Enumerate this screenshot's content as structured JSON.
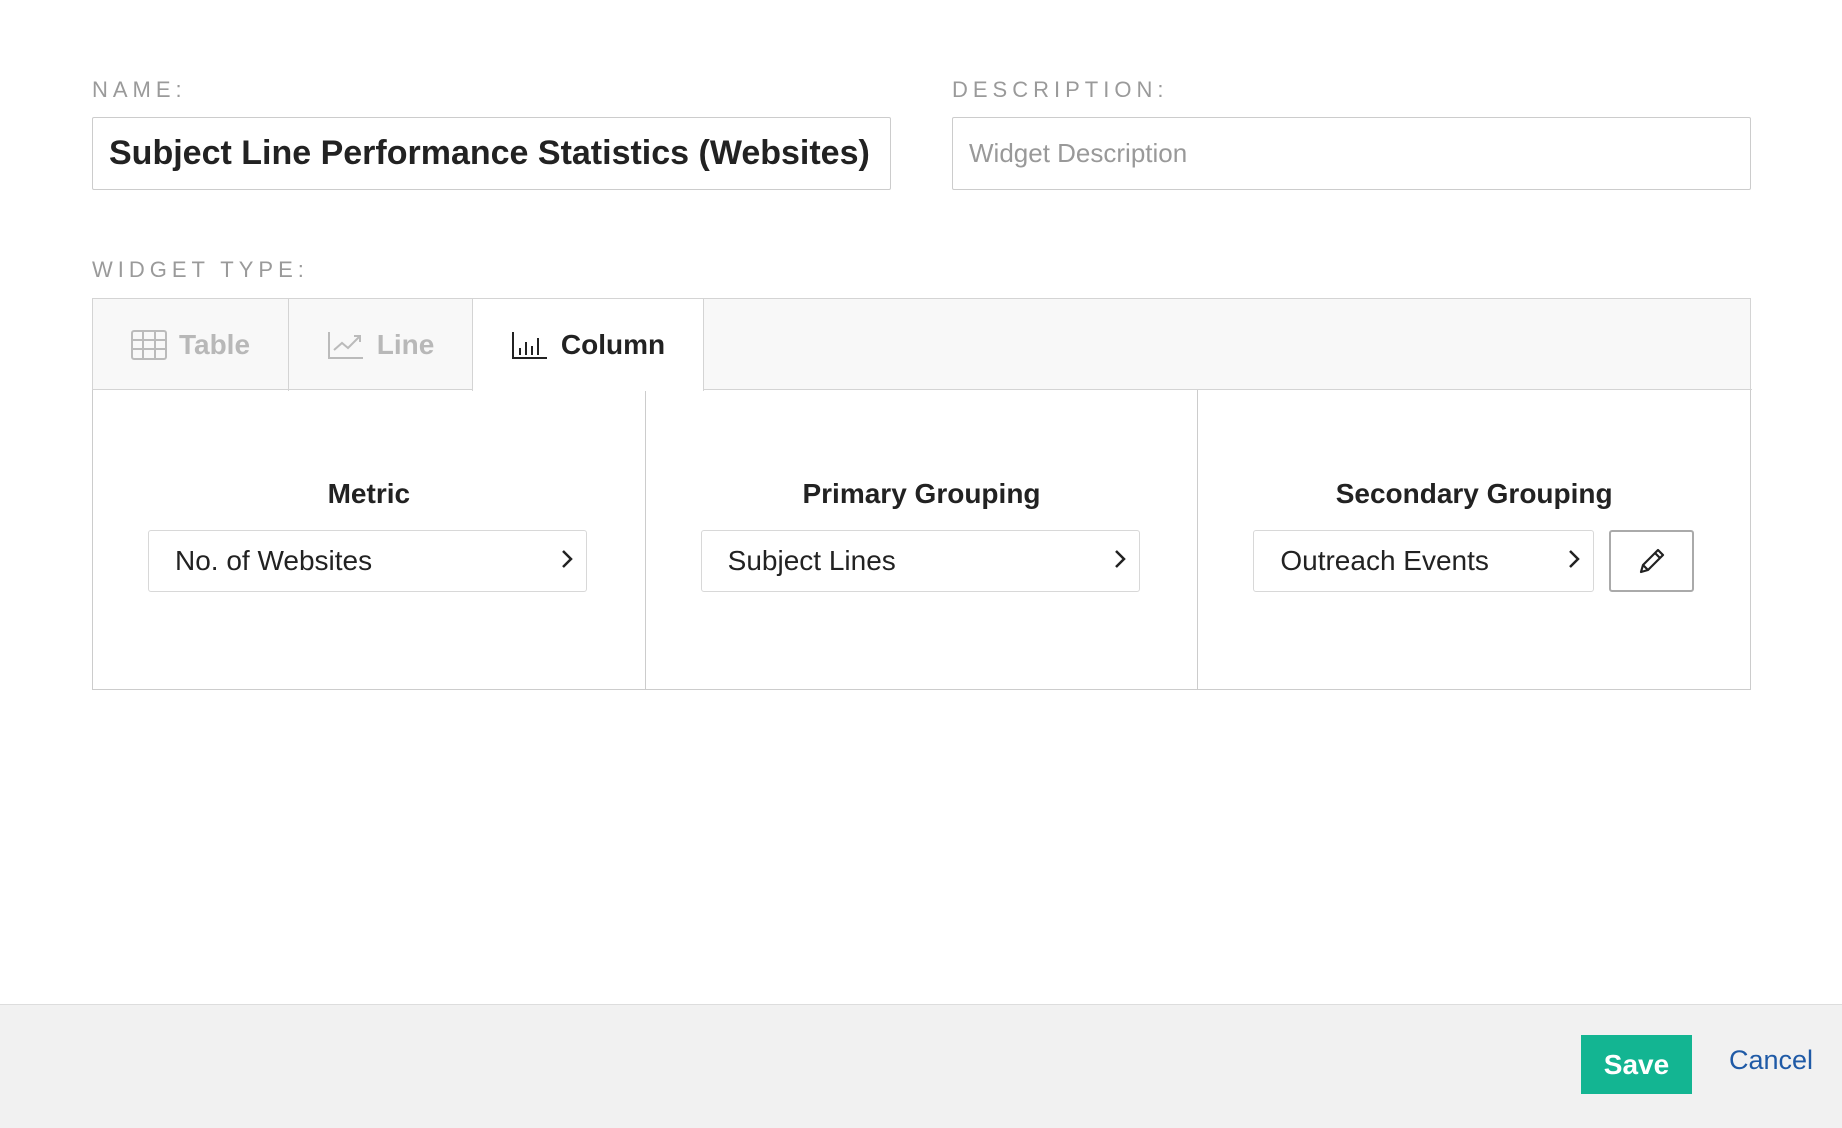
{
  "form": {
    "name_label": "NAME:",
    "name_value": "Subject Line Performance Statistics (Websites)",
    "description_label": "DESCRIPTION:",
    "description_placeholder": "Widget Description",
    "widget_type_label": "WIDGET TYPE:"
  },
  "tabs": [
    {
      "label": "Table",
      "icon": "table-icon",
      "active": false
    },
    {
      "label": "Line",
      "icon": "line-chart-icon",
      "active": false
    },
    {
      "label": "Column",
      "icon": "column-chart-icon",
      "active": true
    }
  ],
  "columns": [
    {
      "heading": "Metric",
      "value": "No. of Websites"
    },
    {
      "heading": "Primary Grouping",
      "value": "Subject Lines"
    },
    {
      "heading": "Secondary Grouping",
      "value": "Outreach Events"
    }
  ],
  "footer": {
    "save_label": "Save",
    "cancel_label": "Cancel"
  },
  "colors": {
    "save": "#13b592",
    "cancel": "#1f5aa6"
  }
}
